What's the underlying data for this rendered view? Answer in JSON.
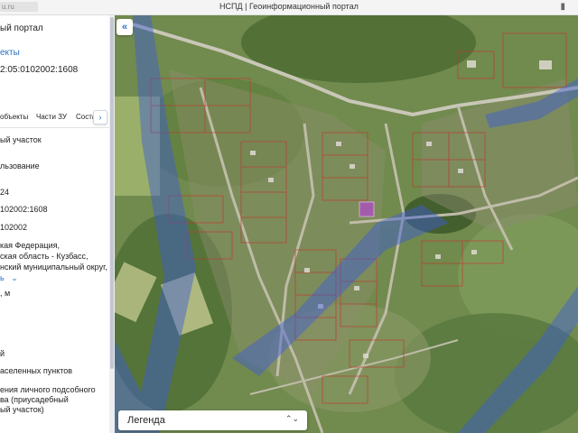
{
  "browser": {
    "url_fragment": "u.ru",
    "title": "НСПД | Геоинформационный портал"
  },
  "panel": {
    "portal_name": "ый портал",
    "objects_link": "екты",
    "cadastral_number": "2:05:0102002:1608",
    "tabs": [
      "объекты",
      "Части ЗУ",
      "Состав"
    ],
    "lines": [
      "ый участок",
      "льзование",
      "24",
      "102002:1608",
      "102002",
      "кая Федерация,",
      "ская область - Кузбасс,",
      "нский муниципальный округ,",
      "ь",
      ", м",
      "й",
      "аселенных пунктов",
      "ения личного подсобного",
      "ва (приусадебный",
      "ый участок)"
    ]
  },
  "map": {
    "legend_label": "Легенда"
  },
  "icons": {
    "collapse": "«",
    "legend_toggle": "⌃⌄",
    "tabs_next": "›",
    "bookmark": "▮",
    "expand": "⌄"
  },
  "colors": {
    "accent": "#2a72c7",
    "cadastral_outline": "#c0392b",
    "zone_overlay": "#3b5bd9"
  }
}
